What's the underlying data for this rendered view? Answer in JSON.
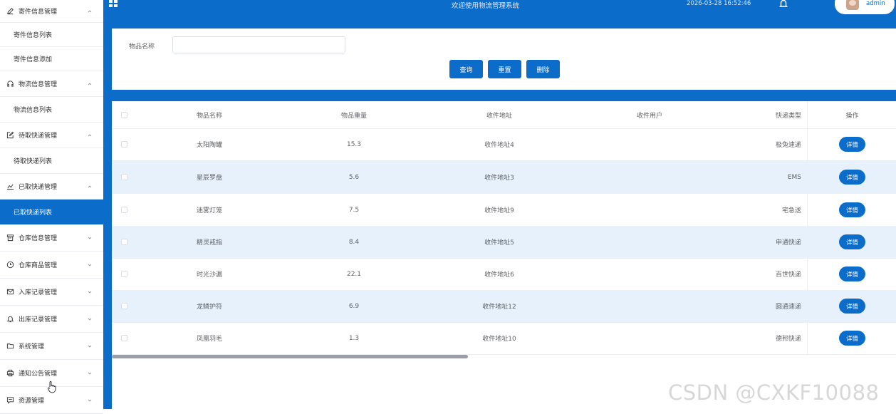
{
  "header": {
    "title": "欢迎使用物流管理系统",
    "datetime": "2026-03-28 16:52:46",
    "username": "admin"
  },
  "sidebar": {
    "items": [
      {
        "label": "寄件信息管理",
        "icon": "edit-icon",
        "kind": "group",
        "expanded": true
      },
      {
        "label": "寄件信息列表",
        "kind": "sub"
      },
      {
        "label": "寄件信息添加",
        "kind": "sub"
      },
      {
        "label": "物流信息管理",
        "icon": "headphones-icon",
        "kind": "group",
        "expanded": true
      },
      {
        "label": "物流信息列表",
        "kind": "sub"
      },
      {
        "label": "待取快递管理",
        "icon": "edit-box-icon",
        "kind": "group",
        "expanded": true
      },
      {
        "label": "待取快递列表",
        "kind": "sub"
      },
      {
        "label": "已取快递管理",
        "icon": "chart-icon",
        "kind": "group",
        "expanded": true
      },
      {
        "label": "已取快递列表",
        "kind": "sub",
        "active": true
      },
      {
        "label": "仓库信息管理",
        "icon": "box-icon",
        "kind": "group",
        "expanded": false
      },
      {
        "label": "仓库商品管理",
        "icon": "clock-icon",
        "kind": "group",
        "expanded": false
      },
      {
        "label": "入库记录管理",
        "icon": "mail-icon",
        "kind": "group",
        "expanded": false
      },
      {
        "label": "出库记录管理",
        "icon": "bell-icon",
        "kind": "group",
        "expanded": false
      },
      {
        "label": "系统管理",
        "icon": "folder-icon",
        "kind": "group",
        "expanded": false
      },
      {
        "label": "通知公告管理",
        "icon": "printer-icon",
        "kind": "group",
        "expanded": false
      },
      {
        "label": "资源管理",
        "icon": "chat-icon",
        "kind": "group",
        "expanded": false
      }
    ]
  },
  "search": {
    "label": "物品名称",
    "value": "",
    "placeholder": "",
    "query_button": "查询",
    "reset_button": "重置",
    "delete_button": "删除"
  },
  "table": {
    "columns": [
      "物品名称",
      "物品重量",
      "收件地址",
      "收件用户",
      "快递类型",
      "操作"
    ],
    "rows": [
      {
        "name": "太阳陶罐",
        "weight": "15.3",
        "address": "收件地址4",
        "user": "",
        "type": "极兔速递",
        "action": "详情"
      },
      {
        "name": "星辰罗盘",
        "weight": "5.6",
        "address": "收件地址3",
        "user": "",
        "type": "EMS",
        "action": "详情"
      },
      {
        "name": "迷雾灯笼",
        "weight": "7.5",
        "address": "收件地址9",
        "user": "",
        "type": "宅急送",
        "action": "详情"
      },
      {
        "name": "精灵戒指",
        "weight": "8.4",
        "address": "收件地址5",
        "user": "",
        "type": "申通快递",
        "action": "详情"
      },
      {
        "name": "时光沙漏",
        "weight": "22.1",
        "address": "收件地址6",
        "user": "",
        "type": "百世快递",
        "action": "详情"
      },
      {
        "name": "龙鳞护符",
        "weight": "6.9",
        "address": "收件地址12",
        "user": "",
        "type": "圆通速递",
        "action": "详情"
      },
      {
        "name": "凤凰羽毛",
        "weight": "1.3",
        "address": "收件地址10",
        "user": "",
        "type": "德邦快递",
        "action": "详情"
      }
    ]
  },
  "watermark": "CSDN @CXKF10088",
  "colors": {
    "primary": "#0b6cc9",
    "stripe": "#e6f1fc",
    "border": "#ebeef5"
  }
}
